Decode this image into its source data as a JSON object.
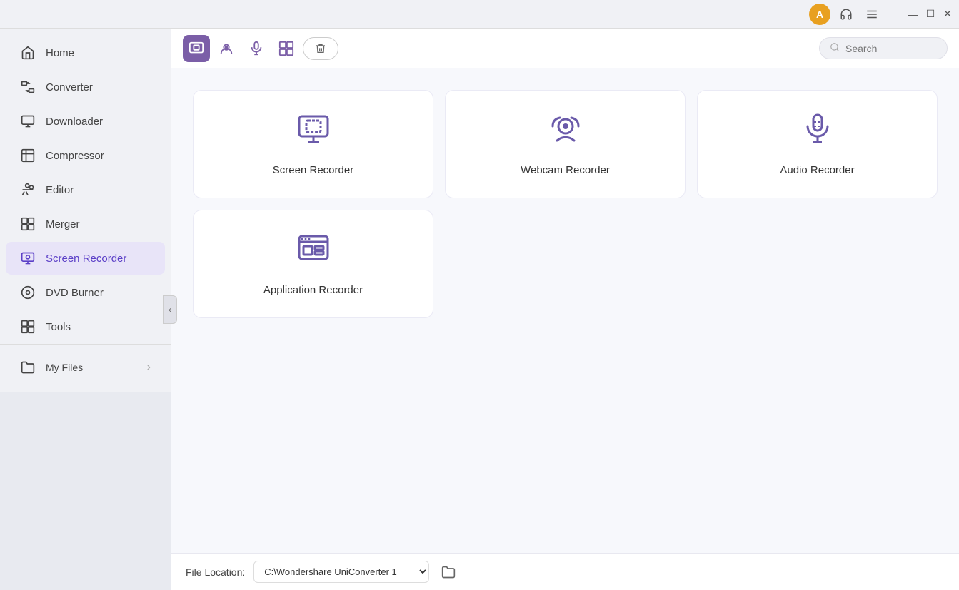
{
  "titlebar": {
    "avatar_initial": "A",
    "headset_title": "Support",
    "menu_title": "Menu",
    "minimize_label": "Minimize",
    "maximize_label": "Maximize",
    "close_label": "Close"
  },
  "sidebar": {
    "home_label": "Home",
    "items": [
      {
        "id": "converter",
        "label": "Converter",
        "icon": "⊞"
      },
      {
        "id": "downloader",
        "label": "Downloader",
        "icon": "⊟"
      },
      {
        "id": "compressor",
        "label": "Compressor",
        "icon": "▣"
      },
      {
        "id": "editor",
        "label": "Editor",
        "icon": "✂"
      },
      {
        "id": "merger",
        "label": "Merger",
        "icon": "⊞"
      },
      {
        "id": "screen-recorder",
        "label": "Screen Recorder",
        "icon": "⊡",
        "active": true
      },
      {
        "id": "dvd-burner",
        "label": "DVD Burner",
        "icon": "⊙"
      },
      {
        "id": "tools",
        "label": "Tools",
        "icon": "⊞"
      }
    ],
    "my_files_label": "My Files"
  },
  "toolbar": {
    "search_placeholder": "Search"
  },
  "recorder_cards": [
    {
      "id": "screen-recorder",
      "label": "Screen Recorder"
    },
    {
      "id": "webcam-recorder",
      "label": "Webcam Recorder"
    },
    {
      "id": "audio-recorder",
      "label": "Audio Recorder"
    },
    {
      "id": "application-recorder",
      "label": "Application Recorder"
    }
  ],
  "file_location": {
    "label": "File Location:",
    "path": "C:\\Wondershare UniConverter 1",
    "dropdown_options": [
      "C:\\Wondershare UniConverter 1"
    ]
  }
}
